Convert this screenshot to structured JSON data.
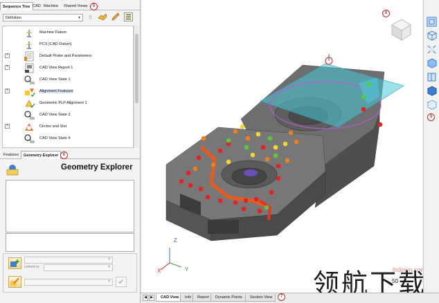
{
  "left_tabs": [
    "Sequence Tree",
    "CAD",
    "Machine",
    "Shared Views"
  ],
  "callouts": {
    "tree_tabs": "5",
    "lower_tabs": "6",
    "bottom_tabs": "7",
    "viewcube": "8",
    "toolbar": "9"
  },
  "definition_dropdown": "Definition",
  "tree_items": [
    {
      "label": "Machine Datum",
      "icon": "datum-icon"
    },
    {
      "label": "PCS (CAD Datum)",
      "icon": "datum-icon"
    },
    {
      "label": "Default Probe and Parameters",
      "icon": "probe-icon"
    },
    {
      "label": "CAD View Report 1",
      "icon": "report-icon"
    },
    {
      "label": "CAD View State 1",
      "icon": "view-state-icon"
    },
    {
      "label": "Alignment Features",
      "icon": "alignment-icon"
    },
    {
      "label": "Geometric PLP Alignment 1",
      "icon": "plp-alignment-icon"
    },
    {
      "label": "CAD View State 2",
      "icon": "view-state-icon"
    },
    {
      "label": "Circles and Slot",
      "icon": "circle-slot-icon"
    },
    {
      "label": "CAD View State 4",
      "icon": "view-state-icon"
    }
  ],
  "lower_tabs": [
    "Features",
    "Geometry Explorer"
  ],
  "geometry_explorer_title": "Geometry Explorer",
  "linked_to_label": "Linked to:",
  "bottom_tabs": [
    "CAD View",
    "Info",
    "Report",
    "Dynamic Points",
    "Section View"
  ],
  "axis_labels": {
    "z": "Z",
    "y": "Y",
    "x": "X"
  },
  "watermark": {
    "site": "lhdown.com",
    "chinese": "领航下载",
    "number": "50"
  },
  "colors": {
    "accent": "#3d7fd6",
    "callout": "#d02020",
    "part": "#5a5a5a",
    "selection": "#49c8d8"
  }
}
